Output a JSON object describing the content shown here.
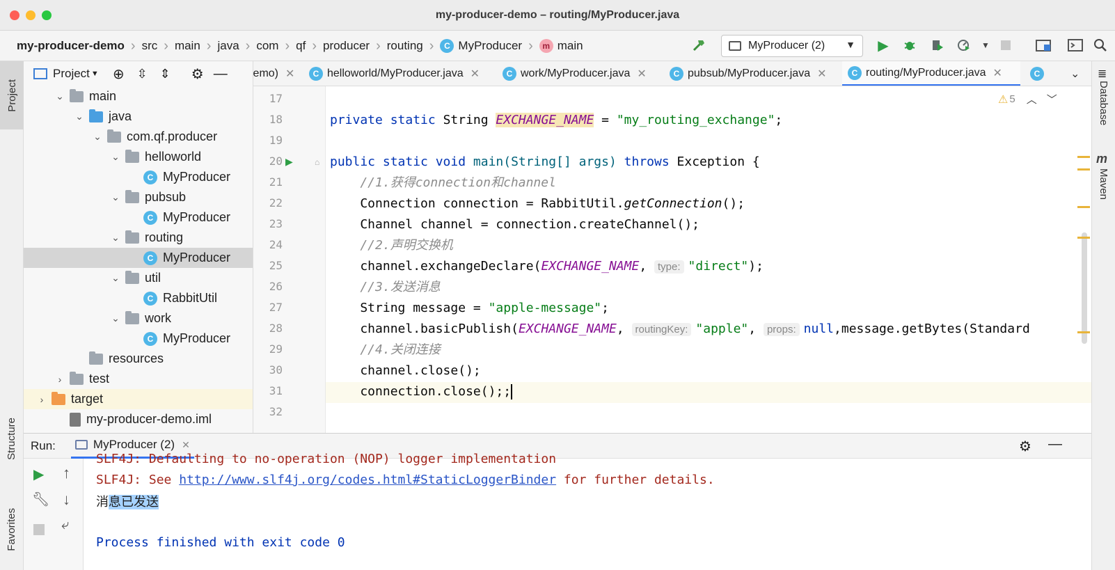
{
  "window": {
    "title": "my-producer-demo – routing/MyProducer.java",
    "traffic_colors": [
      "#fe5f57",
      "#febc2e",
      "#28c840"
    ]
  },
  "breadcrumb": [
    "my-producer-demo",
    "src",
    "main",
    "java",
    "com",
    "qf",
    "producer",
    "routing",
    "MyProducer",
    "main"
  ],
  "toolbar": {
    "run_config": "MyProducer (2)",
    "icons": [
      "hammer-icon",
      "run-icon",
      "debug-icon",
      "coverage-icon",
      "profile-icon",
      "stop-icon",
      "project-structure-icon",
      "ui-icon",
      "search-icon"
    ]
  },
  "left_stripe": {
    "project": "Project",
    "structure": "Structure",
    "favorites": "Favorites"
  },
  "right_stripe": {
    "database": "Database",
    "maven": "Maven"
  },
  "project_panel": {
    "title": "Project",
    "tree": [
      {
        "label": "main",
        "type": "folder",
        "arrow": "v"
      },
      {
        "label": "java",
        "type": "src-folder",
        "arrow": "v"
      },
      {
        "label": "com.qf.producer",
        "type": "package",
        "arrow": "v"
      },
      {
        "label": "helloworld",
        "type": "package",
        "arrow": "v"
      },
      {
        "label": "MyProducer",
        "type": "class",
        "arrow": ""
      },
      {
        "label": "pubsub",
        "type": "package",
        "arrow": "v"
      },
      {
        "label": "MyProducer",
        "type": "class",
        "arrow": ""
      },
      {
        "label": "routing",
        "type": "package",
        "arrow": "v"
      },
      {
        "label": "MyProducer",
        "type": "class",
        "arrow": "",
        "selected": true
      },
      {
        "label": "util",
        "type": "package",
        "arrow": "v"
      },
      {
        "label": "RabbitUtil",
        "type": "class",
        "arrow": ""
      },
      {
        "label": "work",
        "type": "package",
        "arrow": "v"
      },
      {
        "label": "MyProducer",
        "type": "class",
        "arrow": ""
      },
      {
        "label": "resources",
        "type": "resources",
        "arrow": ""
      },
      {
        "label": "test",
        "type": "folder",
        "arrow": ">"
      },
      {
        "label": "target",
        "type": "target",
        "arrow": ">"
      },
      {
        "label": "my-producer-demo.iml",
        "type": "file",
        "arrow": ""
      }
    ]
  },
  "tabs": [
    {
      "label": "lemo)",
      "active": false
    },
    {
      "label": "helloworld/MyProducer.java",
      "active": false
    },
    {
      "label": "work/MyProducer.java",
      "active": false
    },
    {
      "label": "pubsub/MyProducer.java",
      "active": false
    },
    {
      "label": "routing/MyProducer.java",
      "active": true
    }
  ],
  "editor": {
    "warning_count": "5",
    "line_numbers": [
      "17",
      "18",
      "19",
      "20",
      "21",
      "22",
      "23",
      "24",
      "25",
      "26",
      "27",
      "28",
      "29",
      "30",
      "31",
      "32"
    ],
    "hints": {
      "type": "type:",
      "routing_key": "routingKey:",
      "props": "props:"
    },
    "code": {
      "l18_a": "private static ",
      "l18_b": "String ",
      "l18_c": "EXCHANGE_NAME",
      "l18_d": " = ",
      "l18_e": "\"my_routing_exchange\"",
      "l18_f": ";",
      "l20_a": "public static void ",
      "l20_b": "main(String[] args) ",
      "l20_c": "throws ",
      "l20_d": "Exception {",
      "l21": "    //1.获得connection和channel",
      "l22_a": "    Connection connection = RabbitUtil.",
      "l22_b": "getConnection",
      "l22_c": "();",
      "l23": "    Channel channel = connection.createChannel();",
      "l24": "    //2.声明交换机",
      "l25_a": "    channel.exchangeDeclare(",
      "l25_b": "EXCHANGE_NAME",
      "l25_c": ", ",
      "l25_d": "\"direct\"",
      "l25_e": ");",
      "l26": "    //3.发送消息",
      "l27_a": "    String message = ",
      "l27_b": "\"apple-message\"",
      "l27_c": ";",
      "l28_a": "    channel.basicPublish(",
      "l28_b": "EXCHANGE_NAME",
      "l28_c": ", ",
      "l28_d": "\"apple\"",
      "l28_e": ", ",
      "l28_f": "null",
      "l28_g": ",message.getBytes(Standard",
      "l29": "    //4.关闭连接",
      "l30": "    channel.close();",
      "l31": "    connection.close();;"
    }
  },
  "run_panel": {
    "label": "Run:",
    "tab": "MyProducer (2)",
    "console": {
      "line1": "SLF4J: Defaulting to no-operation (NOP) logger implementation",
      "line2_a": "SLF4J: See ",
      "line2_link": "http://www.slf4j.org/codes.html#StaticLoggerBinder",
      "line2_b": " for further details.",
      "line3_a": "消",
      "line3_b": "息已发送",
      "line5": "Process finished with exit code 0"
    }
  }
}
